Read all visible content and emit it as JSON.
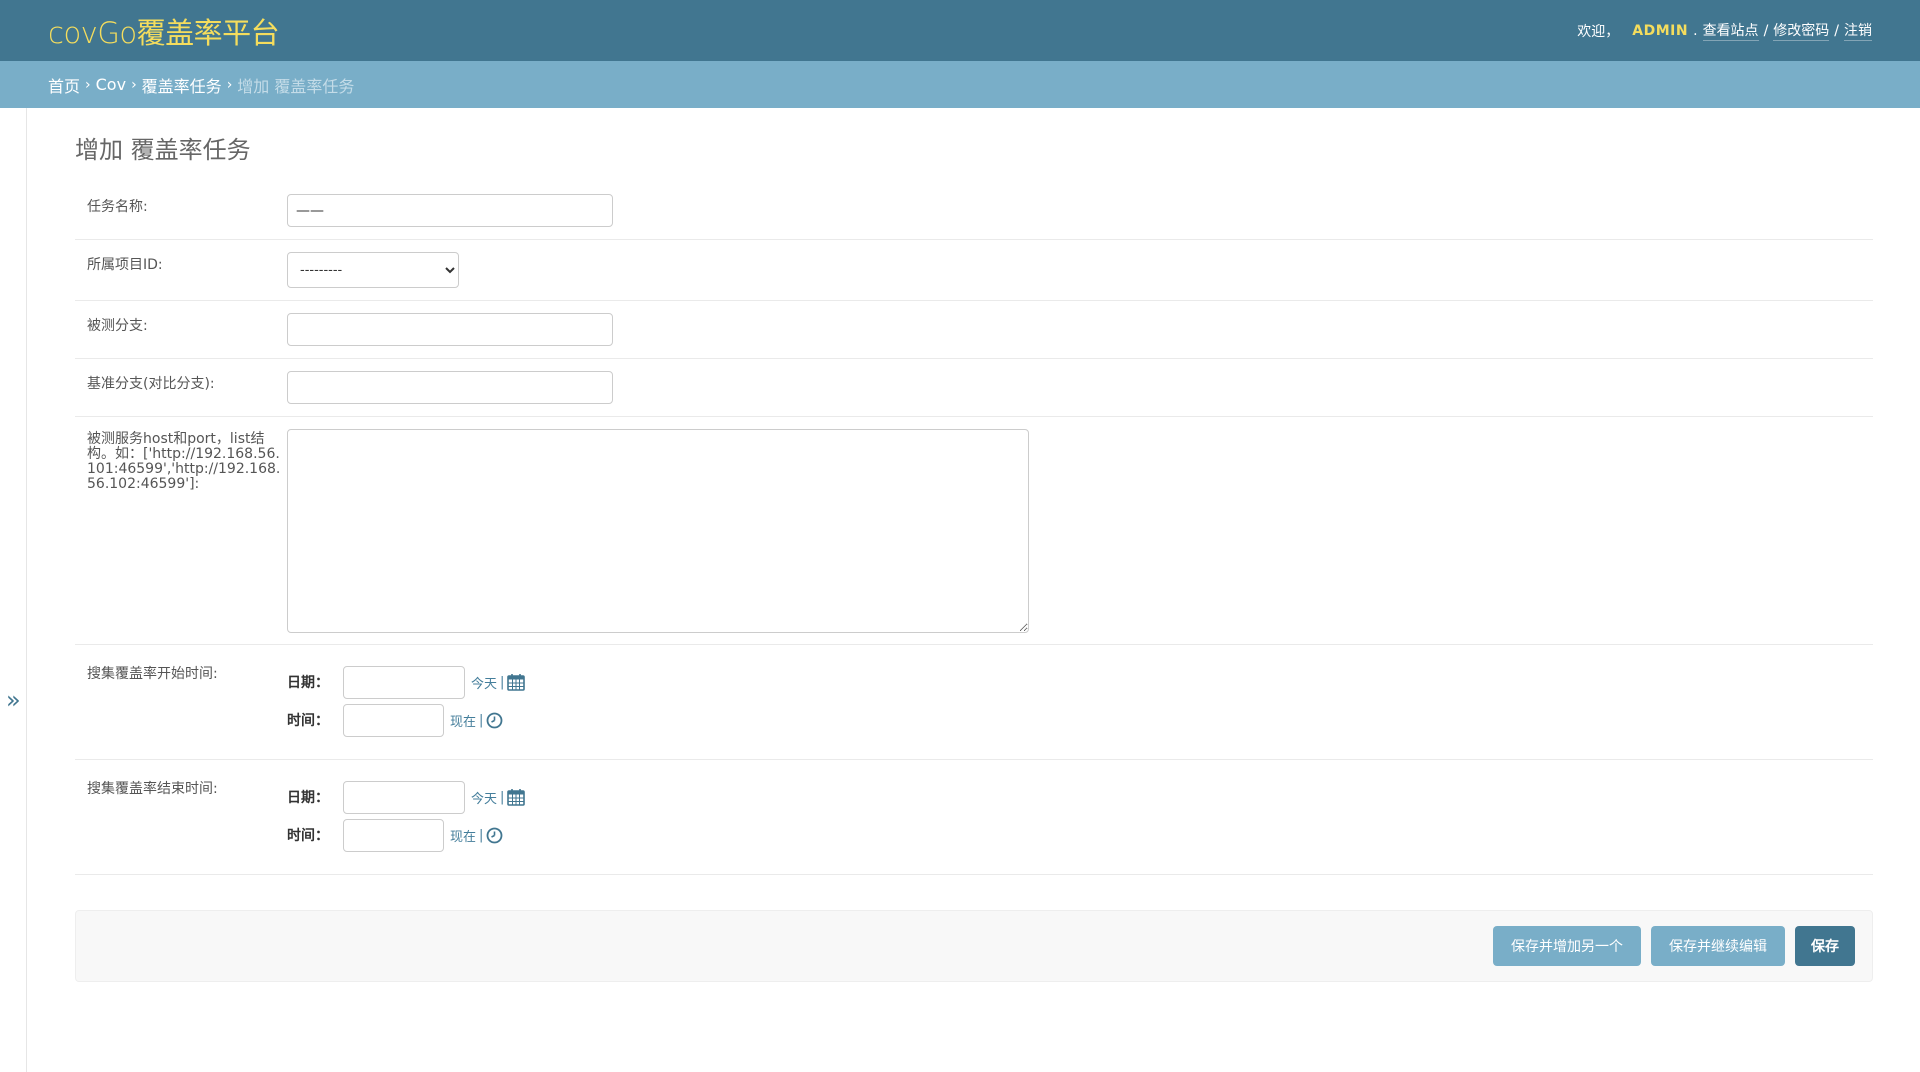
{
  "header": {
    "brand": "covGo覆盖率平台",
    "welcome": "欢迎，",
    "username": "ADMIN",
    "view_site": "查看站点",
    "change_password": "修改密码",
    "logout": "注销",
    "sep": "/"
  },
  "breadcrumbs": {
    "home": "首页",
    "app": "Cov",
    "model": "覆盖率任务",
    "current": "增加 覆盖率任务",
    "chevron": "›"
  },
  "nav_toggle": "»",
  "page": {
    "title": "增加 覆盖率任务"
  },
  "form": {
    "task_name": {
      "label": "任务名称:",
      "value": "——"
    },
    "project_id": {
      "label": "所属项目ID:",
      "selected": "---------"
    },
    "test_branch": {
      "label": "被测分支:",
      "value": ""
    },
    "base_branch": {
      "label": "基准分支(对比分支):",
      "value": ""
    },
    "hosts": {
      "label": "被测服务host和port，list结构。如：['http://192.168.56.101:46599','http://192.168.56.102:46599']:",
      "value": ""
    },
    "start_time": {
      "label": "搜集覆盖率开始时间:",
      "date_label": "日期：",
      "time_label": "时间：",
      "today": "今天",
      "now": "现在",
      "bar": "|"
    },
    "end_time": {
      "label": "搜集覆盖率结束时间:",
      "date_label": "日期：",
      "time_label": "时间：",
      "today": "今天",
      "now": "现在",
      "bar": "|"
    }
  },
  "buttons": {
    "save_add_another": "保存并增加另一个",
    "save_continue": "保存并继续编辑",
    "save": "保存"
  },
  "icons": {
    "calendar": "calendar-icon",
    "clock": "clock-icon"
  },
  "colors": {
    "header_bg": "#417690",
    "breadcrumb_bg": "#79aec8",
    "brand": "#f5dd5d",
    "link": "#447e9b"
  }
}
